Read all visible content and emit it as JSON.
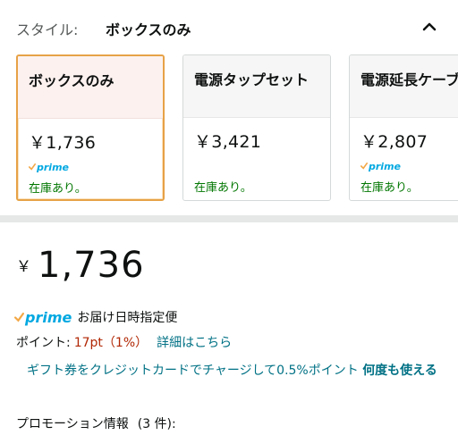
{
  "style": {
    "label": "スタイル:",
    "selected_value": "ボックスのみ"
  },
  "options": [
    {
      "name": "ボックスのみ",
      "price": "￥1,736",
      "prime": "prime",
      "stock": "在庫あり。"
    },
    {
      "name": "電源タップセット",
      "price": "￥3,421",
      "prime": "",
      "stock": "在庫あり。"
    },
    {
      "name": "電源延長ケーブル",
      "price": "￥2,807",
      "prime": "prime",
      "stock": "在庫あり。"
    }
  ],
  "price": {
    "symbol": "￥",
    "amount": "1,736"
  },
  "delivery": {
    "prime": "prime",
    "text": "お届け日時指定便"
  },
  "points": {
    "label": "ポイント:",
    "value": "17pt（1%）",
    "link": "詳細はこちら"
  },
  "promo": {
    "text": "ギフト券をクレジットカードでチャージして0.5%ポイント",
    "bold_text": "何度も使える"
  },
  "promotions": {
    "label": "プロモーション情報",
    "count": "(3 件):"
  },
  "colors": {
    "accent_orange": "#e7a246",
    "price_red": "#b12704",
    "link_teal": "#007185",
    "stock_green": "#007600",
    "prime_blue": "#00a8e1"
  }
}
